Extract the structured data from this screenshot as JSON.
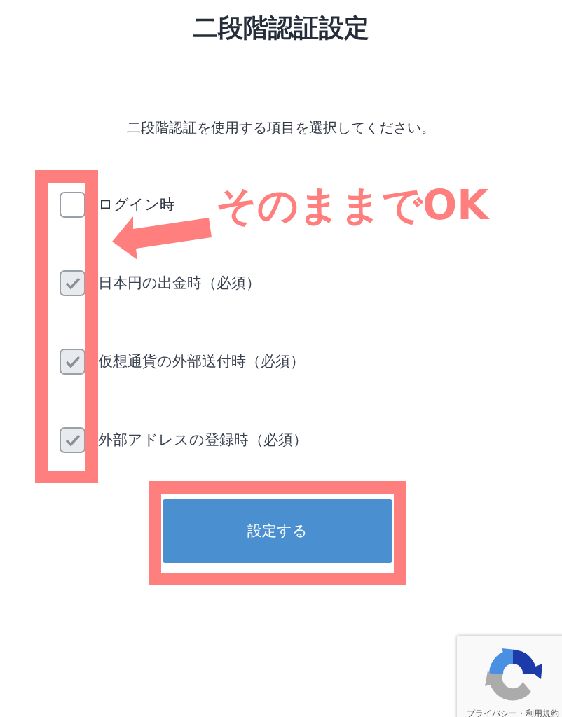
{
  "title": "二段階認証設定",
  "instruction": "二段階認証を使用する項目を選択してください。",
  "options": [
    {
      "label": "ログイン時",
      "checked": false,
      "disabled": false
    },
    {
      "label": "日本円の出金時（必須）",
      "checked": true,
      "disabled": true
    },
    {
      "label": "仮想通貨の外部送付時（必須）",
      "checked": true,
      "disabled": true
    },
    {
      "label": "外部アドレスの登録時（必須）",
      "checked": true,
      "disabled": true
    }
  ],
  "submit_button": "設定する",
  "annotation": {
    "text": "そのままでOK"
  },
  "recaptcha": {
    "links": "プライバシー・利用規約"
  }
}
